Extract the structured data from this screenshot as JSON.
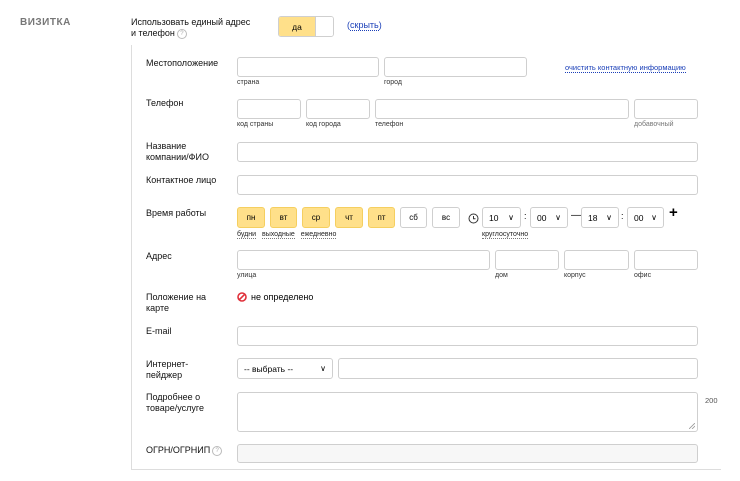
{
  "section_title": "ВИЗИТКА",
  "single_address": {
    "label_line1": "Использовать единый адрес",
    "label_line2": "и телефон",
    "toggle_on": "да",
    "hide_link": "скрыть"
  },
  "location": {
    "label": "Местоположение",
    "country_hint": "страна",
    "city_hint": "город",
    "clear_link": "очистить контактную информацию"
  },
  "phone": {
    "label": "Телефон",
    "country_code_hint": "код страны",
    "city_code_hint": "код города",
    "phone_hint": "телефон",
    "ext_hint": "добавочный"
  },
  "company": {
    "label_line1": "Название",
    "label_line2": "компании/ФИО"
  },
  "contact_person": {
    "label": "Контактное лицо"
  },
  "work_time": {
    "label": "Время работы",
    "days": [
      {
        "label": "пн",
        "on": true
      },
      {
        "label": "вт",
        "on": true
      },
      {
        "label": "ср",
        "on": true
      },
      {
        "label": "чт",
        "on": true
      },
      {
        "label": "пт",
        "on": true
      },
      {
        "label": "сб",
        "on": false
      },
      {
        "label": "вс",
        "on": false
      }
    ],
    "quick_weekdays": "будни",
    "quick_weekends": "выходные",
    "quick_daily": "ежедневно",
    "from_hour": "10",
    "from_min": "00",
    "to_hour": "18",
    "to_min": "00",
    "dash": "—",
    "colon": ":",
    "plus": "+",
    "around_clock": "круглосуточно"
  },
  "address": {
    "label": "Адрес",
    "street_hint": "улица",
    "house_hint": "дом",
    "building_hint": "корпус",
    "office_hint": "офис"
  },
  "map_position": {
    "label_line1": "Положение на",
    "label_line2": "карте",
    "status": "не определено"
  },
  "email": {
    "label": "E-mail"
  },
  "messenger": {
    "label_line1": "Интернет-",
    "label_line2": "пейджер",
    "select_value": "-- выбрать --"
  },
  "details": {
    "label_line1": "Подробнее о",
    "label_line2": "товаре/услуге",
    "char_count": "200"
  },
  "ogrn": {
    "label": "ОГРН/ОГРНИП"
  },
  "colors": {
    "accent_yellow": "#ffe08a",
    "link_blue": "#1a3fb8",
    "error_red": "#e0303a"
  }
}
